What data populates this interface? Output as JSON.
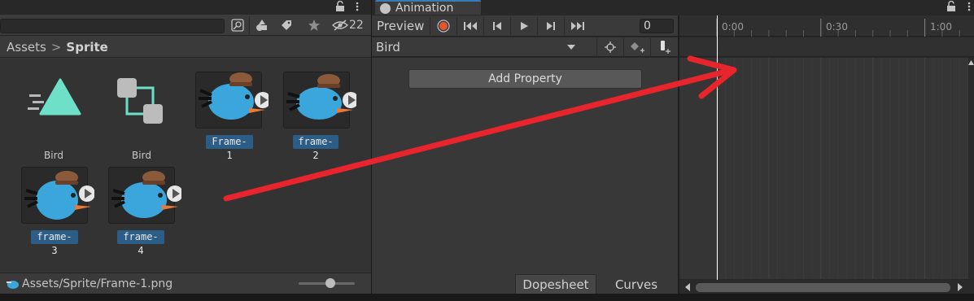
{
  "project": {
    "search_count": "22",
    "breadcrumb": {
      "root": "Assets",
      "separator": ">",
      "current": "Sprite"
    },
    "assets": [
      {
        "label": "Bird",
        "kind": "animator-controller",
        "selected": false
      },
      {
        "label": "Bird",
        "kind": "animation-clip",
        "selected": false
      },
      {
        "label": "Frame-1",
        "kind": "sprite",
        "selected": true
      },
      {
        "label": "frame-2",
        "kind": "sprite",
        "selected": true
      },
      {
        "label": "frame-3",
        "kind": "sprite",
        "selected": true
      },
      {
        "label": "frame-4",
        "kind": "sprite",
        "selected": true
      }
    ],
    "status_path": "Assets/Sprite/Frame-1.png"
  },
  "animation": {
    "tab_title": "Animation",
    "preview_label": "Preview",
    "frame_value": "0",
    "clip_name": "Bird",
    "add_property_label": "Add Property",
    "view_tabs": {
      "dopesheet": "Dopesheet",
      "curves": "Curves"
    },
    "ruler_ticks": [
      "0:00",
      "0:30",
      "1:00"
    ]
  },
  "colors": {
    "accent_red": "#e8242c",
    "selection_blue": "#2c5d87",
    "record_dot": "#e5562a",
    "controller_teal": "#6ee0c8",
    "bird_blue": "#3aa6dc"
  },
  "icons": [
    "search-icon",
    "tag-icon",
    "star-icon",
    "hidden-eye-icon",
    "lock-icon",
    "menu-kebab-icon",
    "record-icon",
    "first-frame-icon",
    "prev-frame-icon",
    "play-icon",
    "next-frame-icon",
    "last-frame-icon",
    "add-key-icon",
    "add-event-icon"
  ]
}
